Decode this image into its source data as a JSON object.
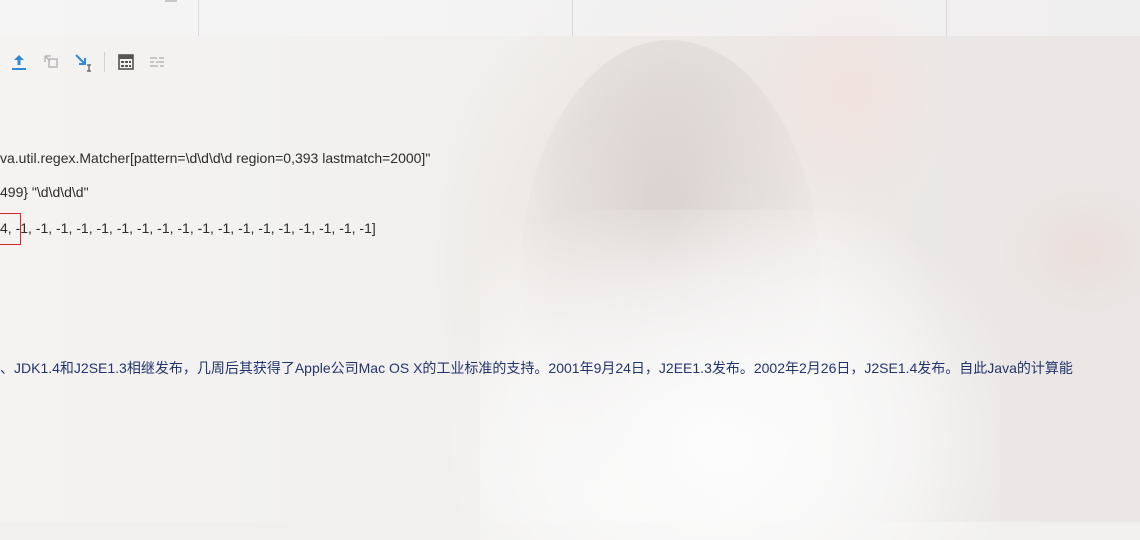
{
  "toolbar": {
    "buttons": [
      {
        "name": "step-out-icon"
      },
      {
        "name": "drop-frame-icon"
      },
      {
        "name": "run-to-cursor-icon"
      },
      {
        "name": "evaluate-expression-icon"
      },
      {
        "name": "trace-current-stream-icon"
      }
    ]
  },
  "debug_values": {
    "matcher_line": "va.util.regex.Matcher[pattern=\\d\\d\\d\\d region=0,393 lastmatch=2000]\"",
    "pattern_line": "499} \"\\d\\d\\d\\d\"",
    "groups_line": "4, -1, -1, -1, -1, -1, -1, -1, -1, -1, -1, -1, -1, -1, -1, -1, -1, -1, -1]"
  },
  "text_content": {
    "chinese_line": "、JDK1.4和J2SE1.3相继发布，几周后其获得了Apple公司Mac OS X的工业标准的支持。2001年9月24日，J2EE1.3发布。2002年2月26日，J2SE1.4发布。自此Java的计算能"
  },
  "colors": {
    "text": "#2c2c2c",
    "cn_text": "#22346d",
    "icon_blue": "#2f8ad8",
    "highlight": "#d42a2a"
  }
}
